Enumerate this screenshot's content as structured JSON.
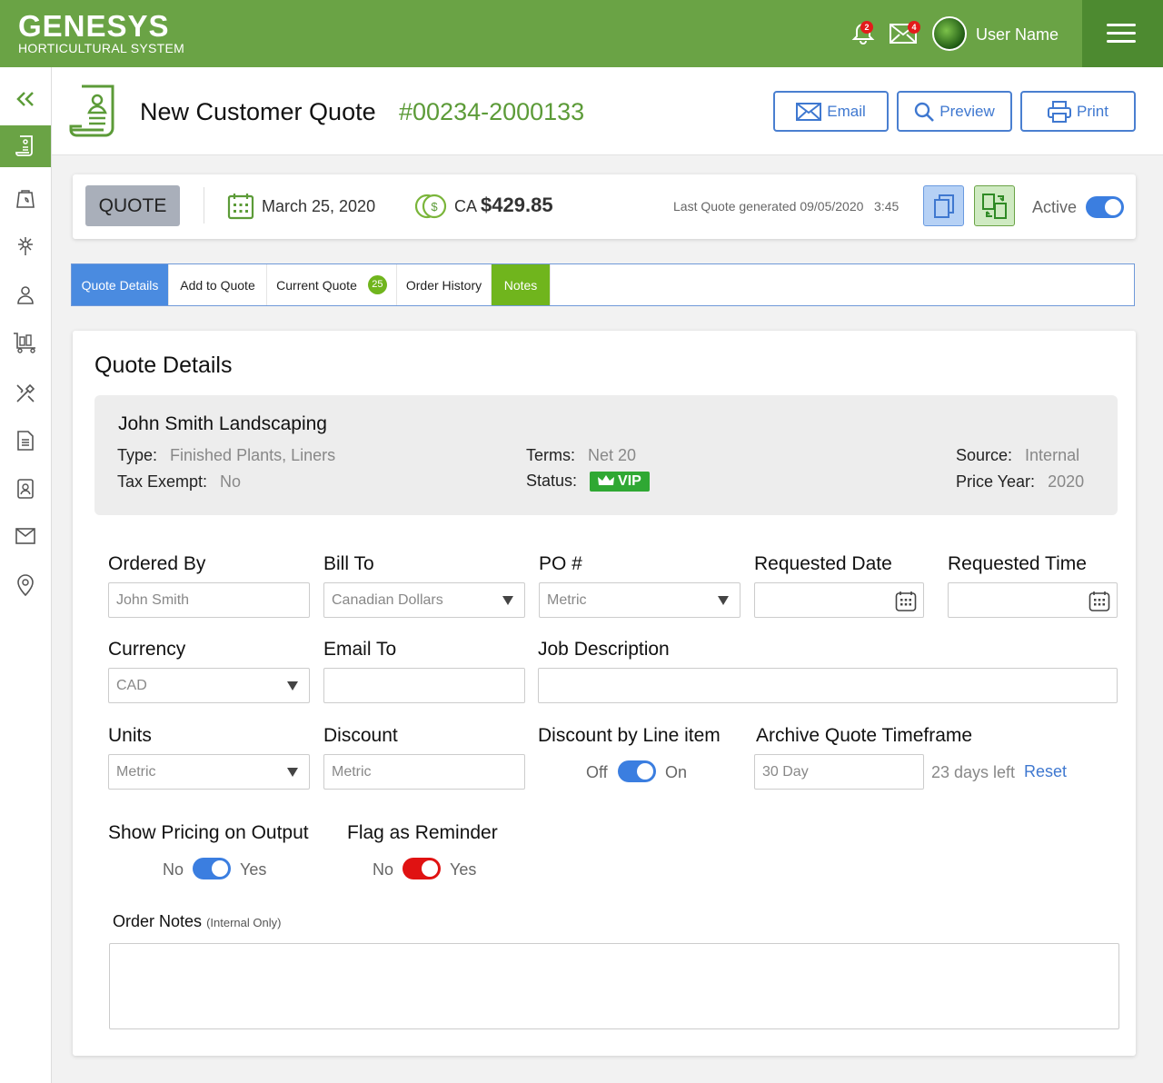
{
  "brand": {
    "name": "GENESYS",
    "subtitle": "HORTICULTURAL SYSTEM"
  },
  "topbar": {
    "notifications_count": "2",
    "messages_count": "4",
    "user_name": "User Name"
  },
  "header": {
    "title": "New Customer Quote",
    "quote_number": "#00234-2000133",
    "email_label": "Email",
    "preview_label": "Preview",
    "print_label": "Print"
  },
  "summary": {
    "type_chip": "QUOTE",
    "date": "March 25, 2020",
    "currency_prefix": "CA",
    "amount": "$429.85",
    "last_generated": "Last Quote generated 09/05/2020   3:45",
    "active_label": "Active",
    "active": true
  },
  "tabs": [
    {
      "label": "Quote Details"
    },
    {
      "label": "Add to Quote"
    },
    {
      "label": "Current Quote",
      "badge": "25"
    },
    {
      "label": "Order History"
    },
    {
      "label": "Notes"
    }
  ],
  "details": {
    "section_title": "Quote Details",
    "customer": {
      "name": "John Smith Landscaping",
      "type_label": "Type:",
      "type_value": "Finished Plants, Liners",
      "tax_label": "Tax Exempt:",
      "tax_value": "No",
      "terms_label": "Terms:",
      "terms_value": "Net 20",
      "status_label": "Status:",
      "status_value": "VIP",
      "source_label": "Source:",
      "source_value": "Internal",
      "price_year_label": "Price Year:",
      "price_year_value": "2020"
    },
    "fields": {
      "ordered_by": {
        "label": "Ordered By",
        "value": "John Smith"
      },
      "bill_to": {
        "label": "Bill To",
        "value": "Canadian Dollars"
      },
      "po": {
        "label": "PO #",
        "value": "Metric"
      },
      "requested_date": {
        "label": "Requested Date",
        "value": ""
      },
      "requested_time": {
        "label": "Requested Time",
        "value": ""
      },
      "currency": {
        "label": "Currency",
        "value": "CAD"
      },
      "email_to": {
        "label": "Email To",
        "value": ""
      },
      "job_description": {
        "label": "Job Description",
        "value": ""
      },
      "units": {
        "label": "Units",
        "value": "Metric"
      },
      "discount": {
        "label": "Discount",
        "value": "Metric"
      },
      "discount_by_line": {
        "label": "Discount by Line item",
        "off": "Off",
        "on": "On",
        "enabled": true
      },
      "archive": {
        "label": "Archive Quote Timeframe",
        "value": "30 Day",
        "days_left": "23 days left",
        "reset": "Reset"
      },
      "show_pricing": {
        "label": "Show Pricing on Output",
        "no": "No",
        "yes": "Yes",
        "enabled": true
      },
      "flag_reminder": {
        "label": "Flag as Reminder",
        "no": "No",
        "yes": "Yes",
        "enabled": true
      }
    },
    "notes": {
      "label": "Order Notes",
      "hint": "(Internal Only)",
      "value": ""
    }
  },
  "colors": {
    "brand_green": "#6aa345",
    "accent_blue": "#3f78d0",
    "tab_blue": "#4a8be0",
    "notes_green": "#70b51d",
    "vip_green": "#2fa833",
    "reminder_red": "#e01212"
  }
}
